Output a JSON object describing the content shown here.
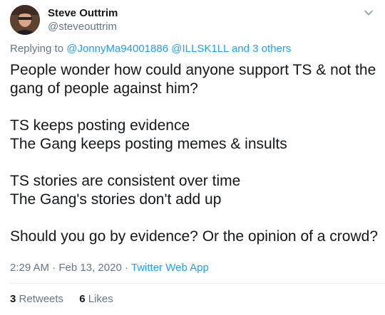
{
  "author": {
    "name": "Steve Outtrim",
    "handle": "@steveouttrim"
  },
  "replying": {
    "prefix": "Replying to",
    "mention_1": "@JonnyMa94001886",
    "mention_2": "@ILLSK1LL",
    "and": "and",
    "others": "3 others"
  },
  "tweet": {
    "line_1": "People wonder how could anyone support TS & not the",
    "line_2": "gang of people against him?",
    "line_3": "TS keeps posting evidence",
    "line_4": "The Gang keeps posting memes & insults",
    "line_5": "TS stories are consistent over time",
    "line_6": "The Gang's stories don't add up",
    "line_7": "Should you go by evidence? Or the opinion of a crowd?"
  },
  "meta": {
    "time": "2:29 AM",
    "separator": "·",
    "date": "Feb 13, 2020",
    "source": "Twitter Web App"
  },
  "stats": {
    "retweets_count": "3",
    "retweets_label": "Retweets",
    "likes_count": "6",
    "likes_label": "Likes"
  },
  "icons": {
    "caret": "chevron-down-icon",
    "avatar": "profile-avatar"
  },
  "colors": {
    "link": "#1da1f2",
    "secondary_text": "#657786",
    "primary_text": "#14171a"
  }
}
